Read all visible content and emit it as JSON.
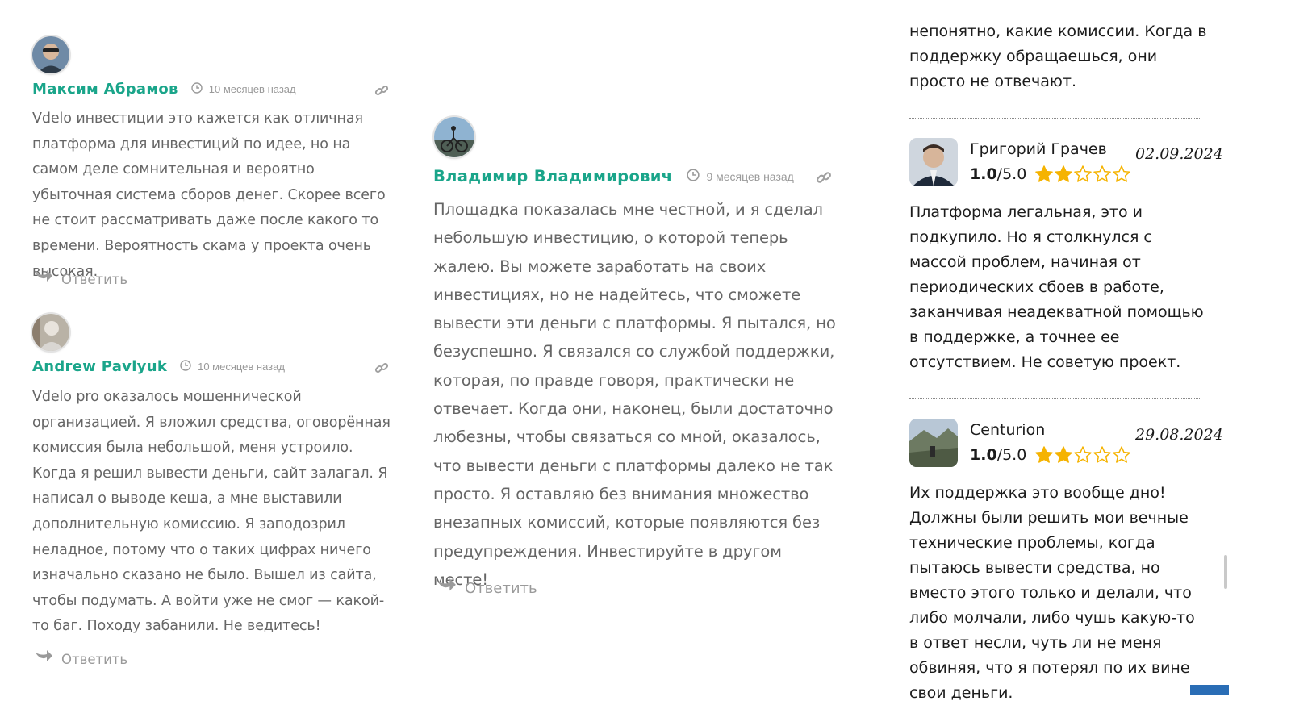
{
  "colors": {
    "author": "#1aa58a",
    "muted": "#9a9a9a",
    "body": "#666666",
    "star": "#f5b301",
    "accent": "#2a6db5"
  },
  "comments": [
    {
      "author": "Максим Абрамов",
      "time": "10 месяцев назад",
      "text": "Vdelo инвестиции это кажется как отличная платформа для инвестиций по идее, но на самом деле сомнительная и вероятно убыточная система сборов денег. Скорее всего не стоит рассматривать даже после какого то времени. Вероятность скама у проекта очень высокая.",
      "reply": "Ответить"
    },
    {
      "author": "Andrew Pavlyuk",
      "time": "10 месяцев назад",
      "text": "Vdelo pro оказалось мошеннической организацией. Я вложил средства, оговорённая комиссия была небольшой, меня устроило. Когда я решил вывести деньги, сайт залагал. Я написал о выводе кеша, а мне выставили дополнительную комиссию. Я заподозрил неладное, потому что о таких цифрах ничего изначально сказано не было. Вышел из сайта, чтобы подумать. А войти уже не смог — какой-то баг. Походу забанили. Не ведитесь!",
      "reply": "Ответить"
    },
    {
      "author": "Владимир Владимирович",
      "time": "9 месяцев назад",
      "text": "Площадка показалась мне честной, и я сделал небольшую инвестицию, о которой теперь жалею. Вы можете заработать на своих инвестициях, но не надейтесь, что сможете вывести эти деньги с платформы. Я пытался, но безуспешно. Я связался со службой поддержки, которая, по правде говоря, практически не отвечает. Когда они, наконец, были достаточно любезны, чтобы связаться со мной, оказалось, что вывести деньги с платформы далеко не так просто. Я оставляю без внимания множество внезапных комиссий, которые появляются без предупреждения. Инвестируйте в другом месте!",
      "reply": "Ответить"
    }
  ],
  "reviews_top_text": "непонятно, какие комиссии. Когда в поддержку обращаешься, они просто не отвечают.",
  "reviews": [
    {
      "name": "Григорий Грачев",
      "rating_value": "1.0",
      "rating_max": "/5.0",
      "stars_filled": 2,
      "stars_total": 5,
      "date": "02.09.2024",
      "text": "Платформа легальная, это и подкупило. Но я столкнулся с массой проблем, начиная от периодических сбоев в работе, заканчивая неадекватной помощью в поддержке, а точнее ее отсутствием. Не советую проект."
    },
    {
      "name": "Centurion",
      "rating_value": "1.0",
      "rating_max": "/5.0",
      "stars_filled": 2,
      "stars_total": 5,
      "date": "29.08.2024",
      "text": "Их поддержка это вообще дно! Должны были решить мои вечные технические проблемы, когда пытаюсь вывести средства, но вместо этого только и делали, что либо молчали, либо чушь какую-то в ответ несли, чуть ли не меня обвиняя, что я потерял по их вине свои деньги."
    }
  ]
}
